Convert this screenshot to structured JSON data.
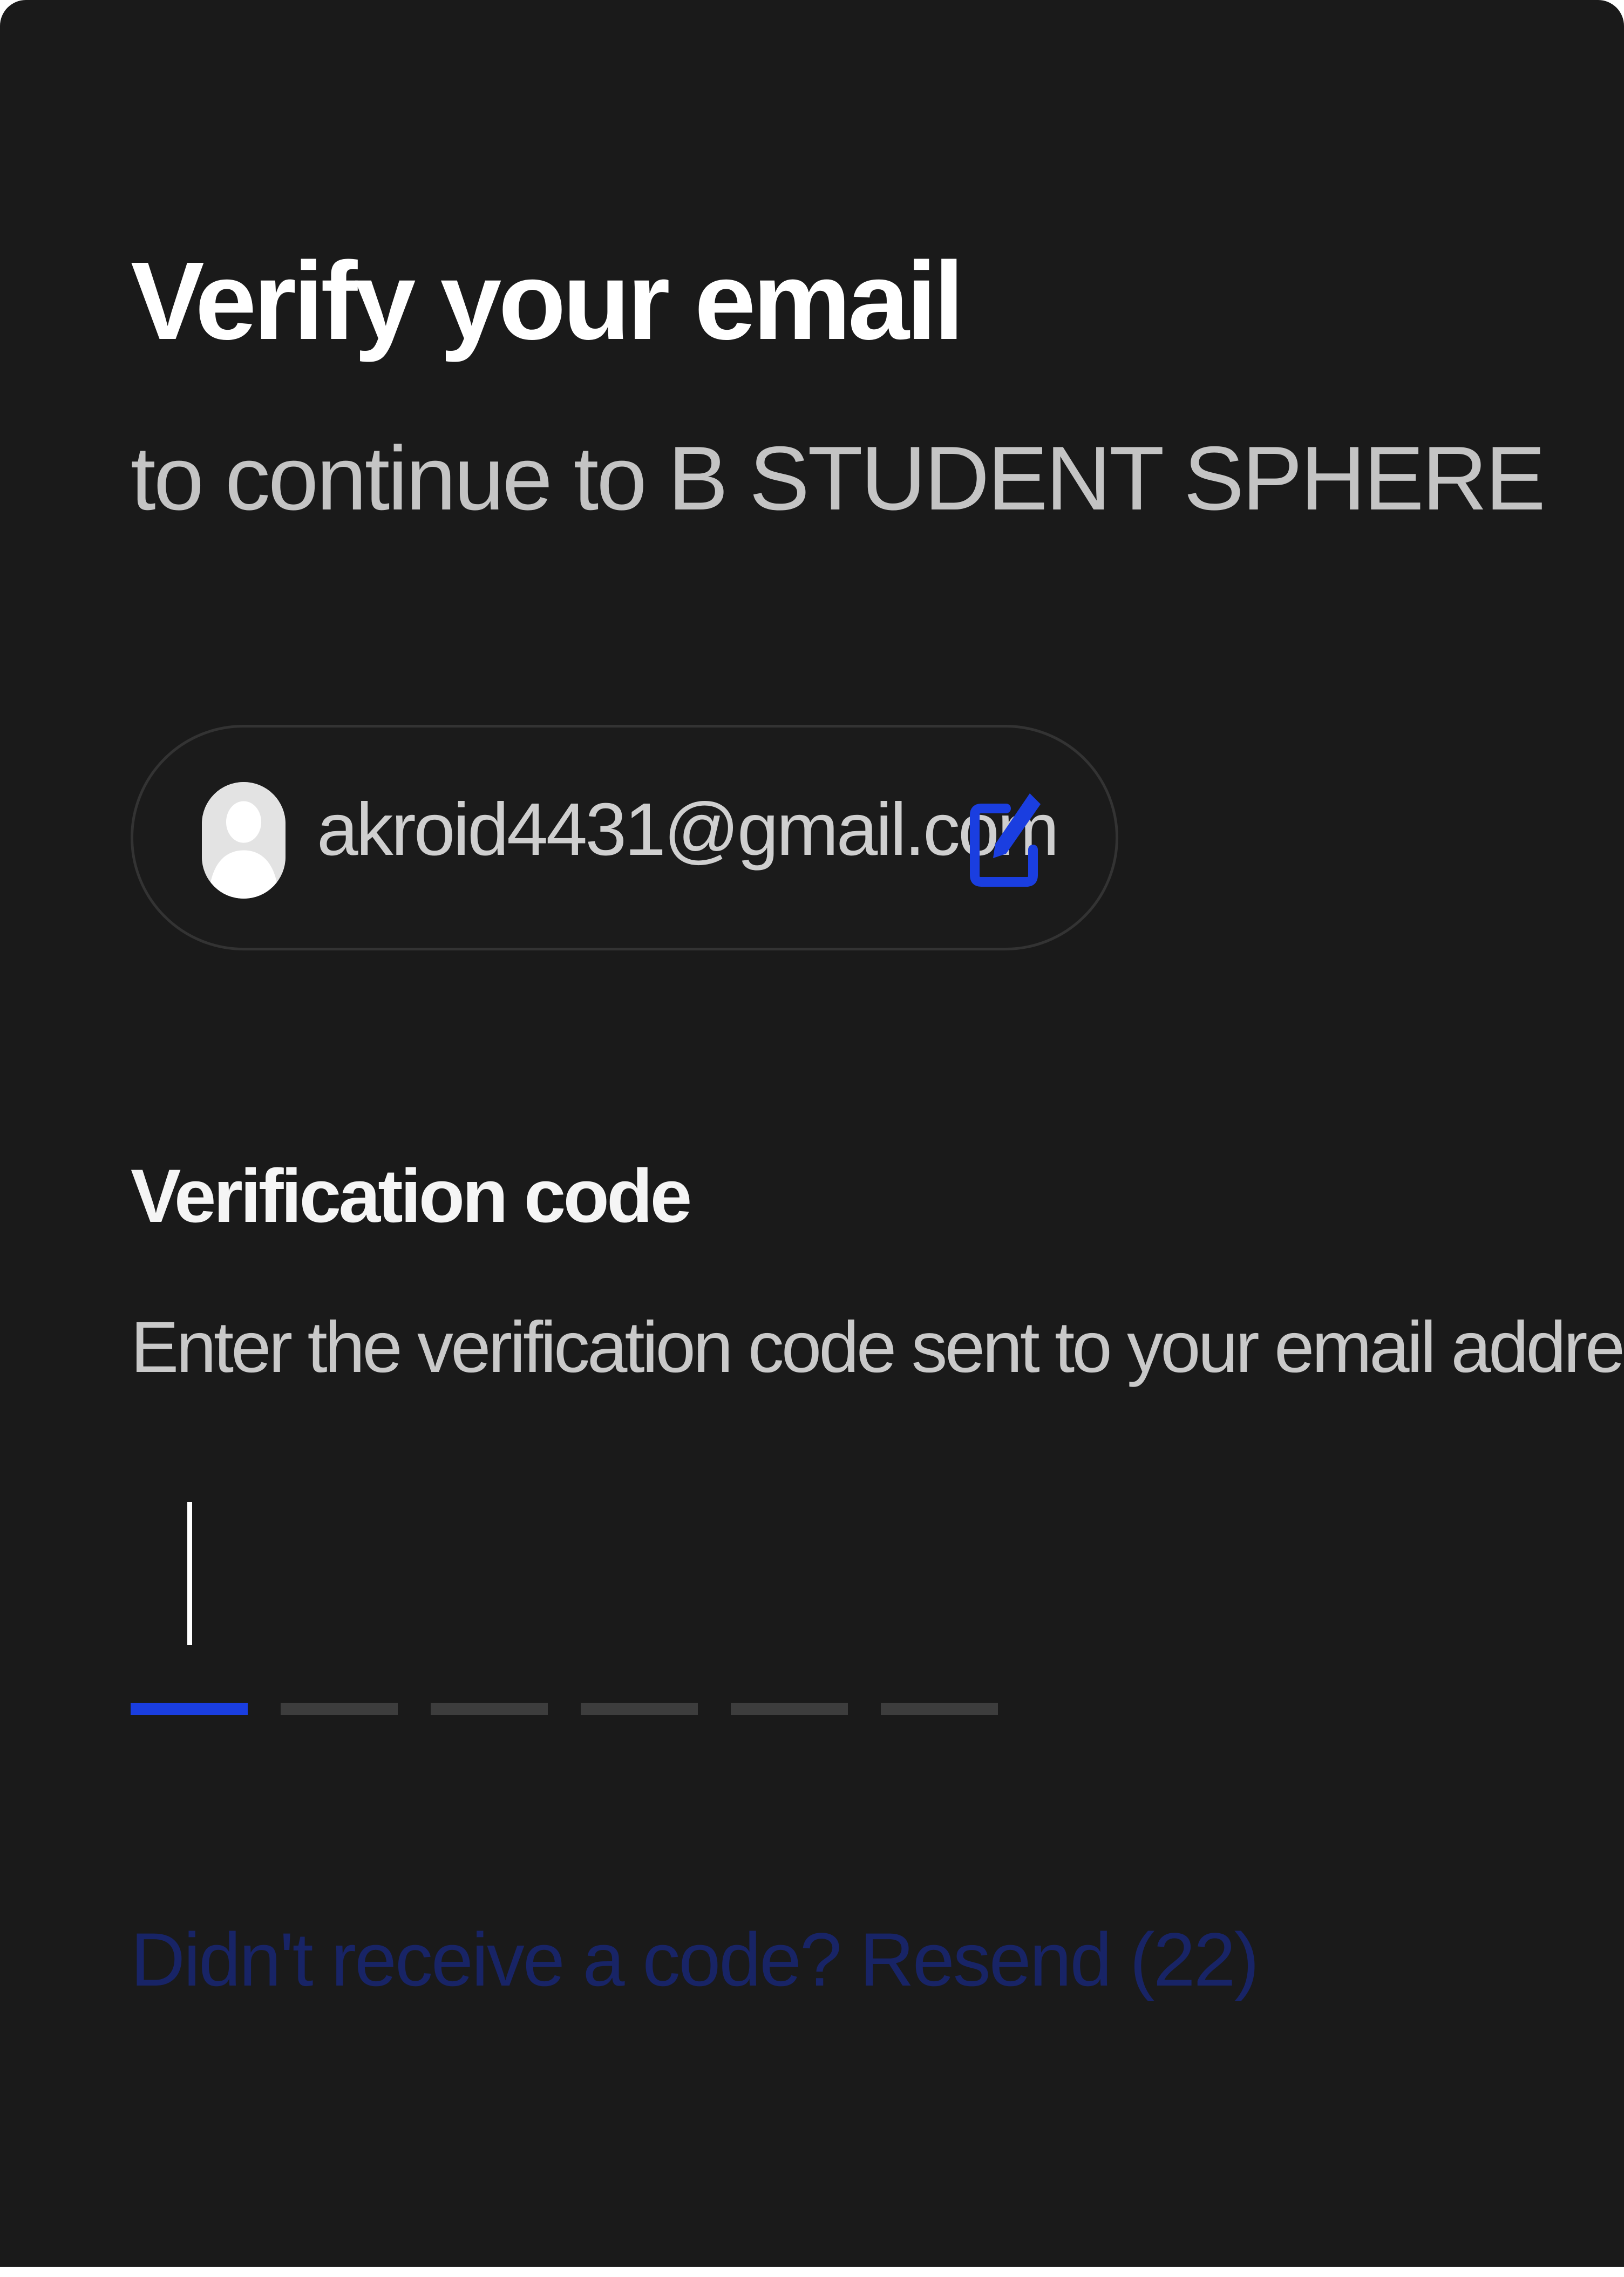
{
  "header": {
    "title": "Verify your email",
    "subtitle": "to continue to B STUDENT SPHERE"
  },
  "identity": {
    "email": "akroid4431@gmail.com",
    "avatar_icon": "user-silhouette-icon",
    "edit_icon": "edit-pencil-icon"
  },
  "verification": {
    "label": "Verification code",
    "help_text": "Enter the verification code sent to your email address",
    "digits": [
      "",
      "",
      "",
      "",
      "",
      ""
    ],
    "active_index": 0
  },
  "resend": {
    "text": "Didn't receive a code? Resend (22)"
  },
  "colors": {
    "background": "#1a1a1a",
    "accent": "#1a3ee0",
    "inactive_slot": "#3d3d3d",
    "resend_disabled": "#182466"
  }
}
